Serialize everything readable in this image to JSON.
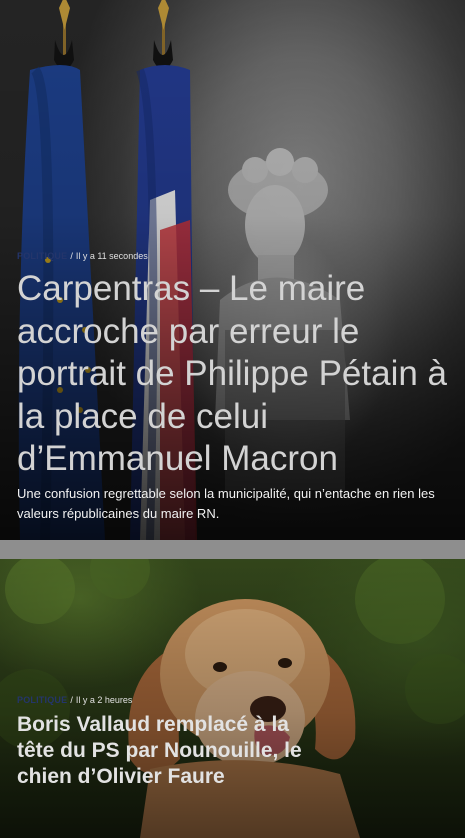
{
  "articles": [
    {
      "category": "POLITIQUE",
      "separator": "/",
      "time": "Il y a 11 secondes",
      "title": "Carpentras – Le maire accroche par erreur le portrait de Philippe Pétain à la place de celui d’Emmanuel Macron",
      "summary": "Une confusion regrettable selon la municipalité, qui n’entache en rien les valeurs républicaines du maire RN.",
      "image_icon": "flags-and-marianne-bust-photo"
    },
    {
      "category": "POLITIQUE",
      "separator": "/",
      "time": "Il y a 2 heures",
      "title": "Boris Vallaud remplacé à la tête du PS par Nounouille, le chien d’Olivier Faure",
      "image_icon": "golden-retriever-photo"
    }
  ],
  "colors": {
    "category": "#24356b",
    "divider": "#8e8e8e"
  }
}
